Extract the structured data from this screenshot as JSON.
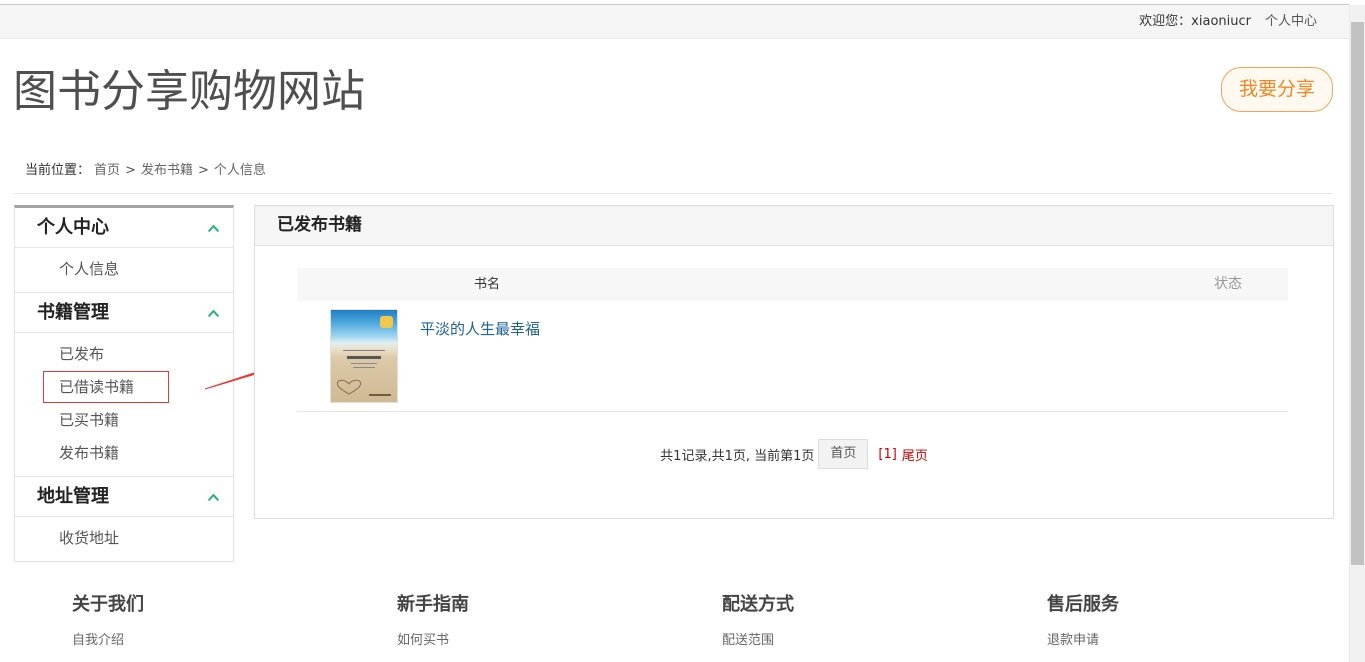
{
  "topbar": {
    "welcome_label": "欢迎您：",
    "username": "xiaoniucr",
    "user_center": "个人中心"
  },
  "header": {
    "site_title": "图书分享购物网站",
    "share_button": "我要分享"
  },
  "breadcrumb": {
    "label": "当前位置：",
    "separator": ">",
    "items": [
      "首页",
      "发布书籍",
      "个人信息"
    ]
  },
  "sidebar": {
    "sections": [
      {
        "title": "个人中心",
        "expanded": true,
        "items": [
          {
            "label": "个人信息"
          }
        ]
      },
      {
        "title": "书籍管理",
        "expanded": true,
        "items": [
          {
            "label": "已发布"
          },
          {
            "label": "已借读书籍",
            "annotated": true
          },
          {
            "label": "已买书籍"
          },
          {
            "label": "发布书籍"
          }
        ]
      },
      {
        "title": "地址管理",
        "expanded": true,
        "items": [
          {
            "label": "收货地址"
          }
        ]
      }
    ]
  },
  "main": {
    "panel_title": "已发布书籍",
    "table": {
      "columns": [
        "书名",
        "状态"
      ],
      "rows": [
        {
          "title": "平淡的人生最幸福"
        }
      ]
    },
    "pagination": {
      "summary": "共1记录,共1页, 当前第1页",
      "first_button": "首页",
      "current_page": "[1]",
      "last_link": "尾页"
    }
  },
  "footer": {
    "columns": [
      {
        "title": "关于我们",
        "links": [
          "自我介绍"
        ]
      },
      {
        "title": "新手指南",
        "links": [
          "如何买书"
        ]
      },
      {
        "title": "配送方式",
        "links": [
          "配送范围"
        ]
      },
      {
        "title": "售后服务",
        "links": [
          "退款申请"
        ]
      }
    ]
  },
  "icons": {
    "section_toggle": "chevron-up-icon",
    "annotation": "red-arrow-icon"
  },
  "colors": {
    "share_accent": "#ec8827",
    "chevron_green": "#26b07c",
    "link_blue": "#1e6296",
    "pagination_red": "#cc0000",
    "annotation_red": "#e4393c"
  }
}
